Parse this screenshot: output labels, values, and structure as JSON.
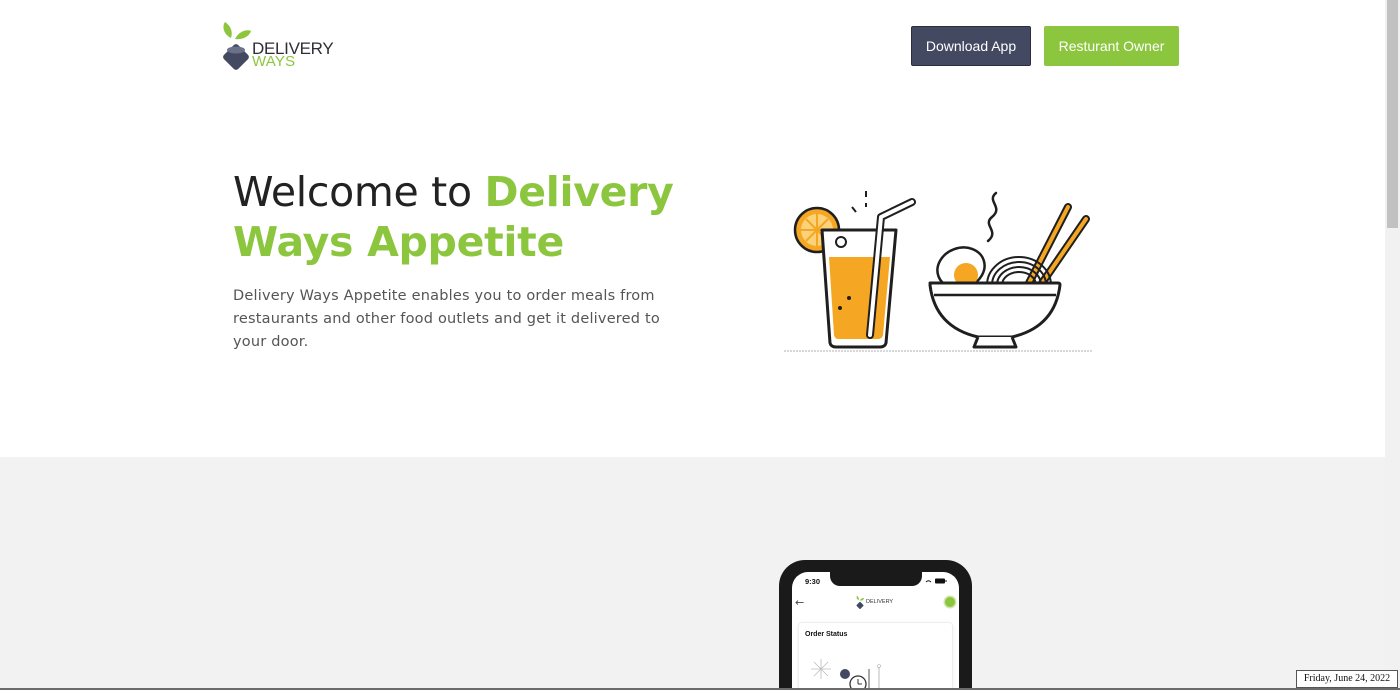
{
  "header": {
    "logo": {
      "word_top": "DELIVERY",
      "word_bottom": "WAYS",
      "icon": "leaf-plate-logo-icon"
    },
    "download_label": "Download App",
    "owner_label": "Resturant Owner"
  },
  "hero": {
    "title_prefix": "Welcome to ",
    "title_accent": "Delivery Ways Appetite",
    "description": "Delivery Ways Appetite enables you to order meals from restaurants and other food outlets and get it delivered to your door.",
    "illustration_icon": "juice-and-noodle-bowl-icon"
  },
  "phone_preview": {
    "time": "9:30",
    "logo_text": "DELIVERY",
    "back_icon": "back-arrow-icon",
    "card_title": "Order Status"
  },
  "system": {
    "date_tooltip": "Friday, June 24, 2022"
  },
  "colors": {
    "brand_green": "#8cc63f",
    "brand_navy": "#424961",
    "section_grey": "#f2f2f2"
  }
}
